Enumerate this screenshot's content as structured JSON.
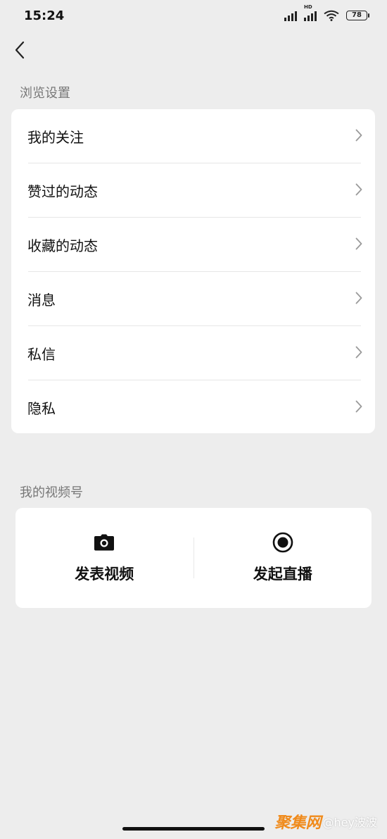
{
  "status_bar": {
    "time": "15:24",
    "battery": "78",
    "network_label": "HD",
    "icons": [
      "signal-icon",
      "hd-signal-icon",
      "wifi-icon",
      "battery-icon"
    ]
  },
  "nav": {
    "back_icon": "chevron-left-icon"
  },
  "browse_settings": {
    "title": "浏览设置",
    "items": [
      {
        "label": "我的关注"
      },
      {
        "label": "赞过的动态"
      },
      {
        "label": "收藏的动态"
      },
      {
        "label": "消息"
      },
      {
        "label": "私信"
      },
      {
        "label": "隐私"
      }
    ]
  },
  "video_account": {
    "title": "我的视频号",
    "actions": [
      {
        "label": "发表视频",
        "icon": "camera-icon"
      },
      {
        "label": "发起直播",
        "icon": "live-record-icon"
      }
    ]
  },
  "watermark": {
    "logo": "聚集网",
    "user": "@hey波波"
  }
}
